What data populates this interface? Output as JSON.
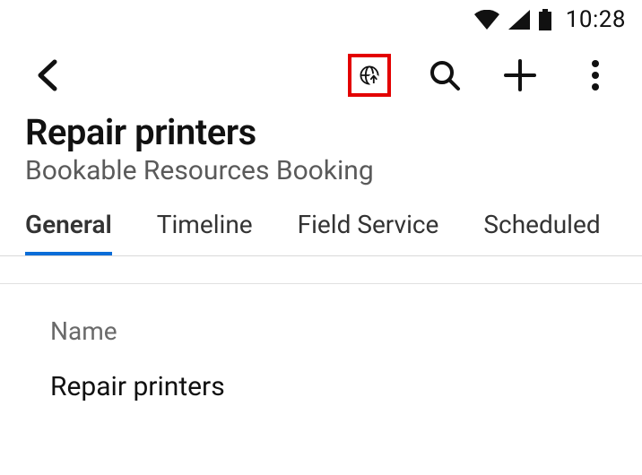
{
  "status": {
    "time": "10:28"
  },
  "header": {
    "title": "Repair printers",
    "subtitle": "Bookable Resources Booking"
  },
  "tabs": [
    {
      "label": "General",
      "active": true
    },
    {
      "label": "Timeline",
      "active": false
    },
    {
      "label": "Field Service",
      "active": false
    },
    {
      "label": "Scheduled",
      "active": false
    }
  ],
  "fields": {
    "name": {
      "label": "Name",
      "value": "Repair printers"
    }
  },
  "annotations": {
    "highlighted_action": "globe-upload-icon"
  }
}
